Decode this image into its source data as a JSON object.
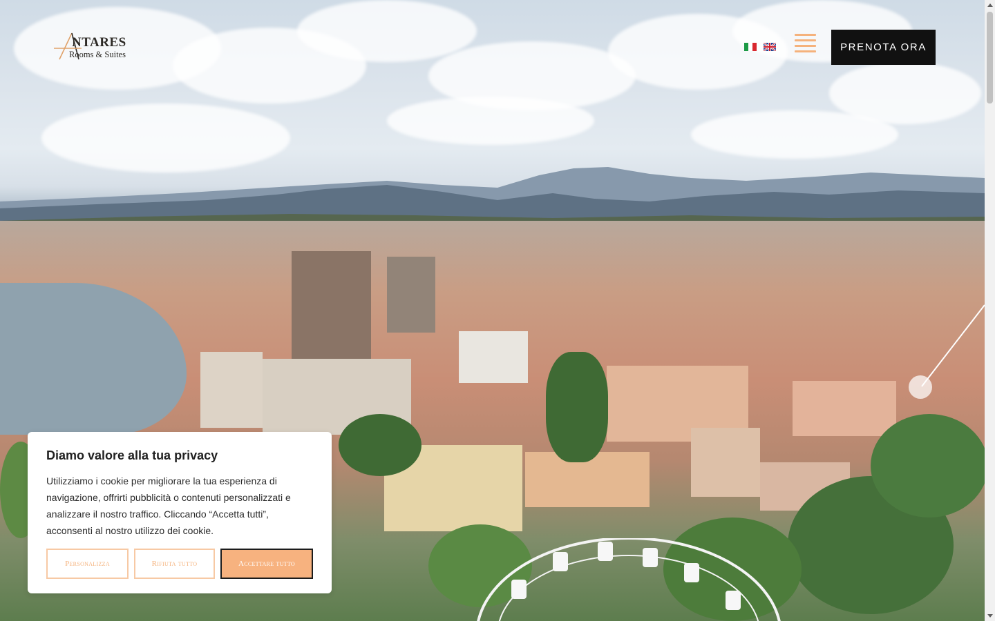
{
  "header": {
    "logo": {
      "name": "NTARES",
      "subtitle": "Rooms & Suites"
    },
    "languages": [
      {
        "code": "it",
        "icon": "italy-flag-icon"
      },
      {
        "code": "en",
        "icon": "uk-flag-icon"
      }
    ],
    "menu_icon": "hamburger-menu-icon",
    "cta_label": "PRENOTA ORA"
  },
  "cookie_banner": {
    "title": "Diamo valore alla tua privacy",
    "text": "Utilizziamo i cookie per migliorare la tua esperienza di navigazione, offrirti pubblicità o contenuti personalizzati e analizzare il nostro traffico. Cliccando “Accetta tutti”, acconsenti al nostro utilizzo dei cookie.",
    "buttons": {
      "customize": "Personalizza",
      "reject": "Rifiuta tutto",
      "accept": "Accettare tutto"
    }
  },
  "colors": {
    "accent": "#f5b27c",
    "cta_bg": "#111111",
    "accept_bg": "#f7b27f"
  }
}
